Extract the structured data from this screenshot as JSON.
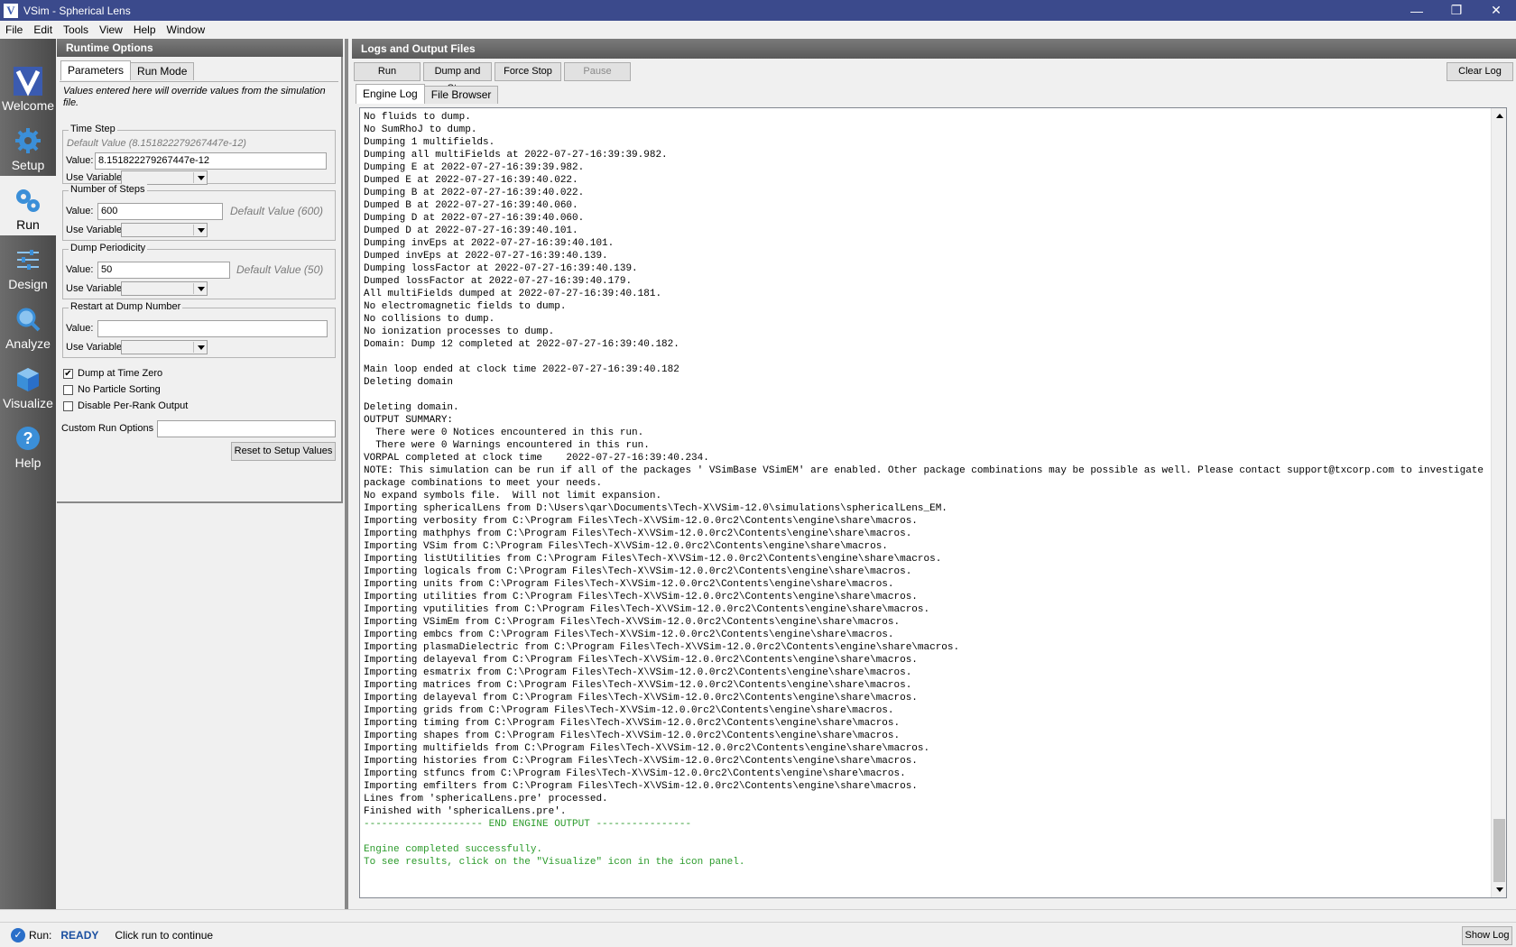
{
  "window": {
    "title": "VSim - Spherical Lens",
    "app_icon": "V",
    "minimize": "—",
    "restore": "❐",
    "close": "✕"
  },
  "menu": [
    "File",
    "Edit",
    "Tools",
    "View",
    "Help",
    "Window"
  ],
  "iconpanel": {
    "items": [
      {
        "label": "Welcome",
        "icon": "vsim-logo-icon"
      },
      {
        "label": "Setup",
        "icon": "gear-icon"
      },
      {
        "label": "Run",
        "icon": "gears-icon",
        "active": true
      },
      {
        "label": "Design",
        "icon": "sliders-icon"
      },
      {
        "label": "Analyze",
        "icon": "magnifier-icon"
      },
      {
        "label": "Visualize",
        "icon": "cube-icon"
      },
      {
        "label": "Help",
        "icon": "question-icon"
      }
    ]
  },
  "runtime": {
    "header": "Runtime Options",
    "tabs": [
      "Parameters",
      "Run Mode"
    ],
    "note": "Values entered here will override values from the simulation file.",
    "time_step": {
      "title": "Time Step",
      "default": "Default Value (8.151822279267447e-12)",
      "value_label": "Value:",
      "value": "8.151822279267447e-12",
      "use_var_label": "Use Variable:"
    },
    "num_steps": {
      "title": "Number of Steps",
      "value_label": "Value:",
      "value": "600",
      "default": "Default Value (600)",
      "use_var_label": "Use Variable:"
    },
    "dump_periodicity": {
      "title": "Dump Periodicity",
      "value_label": "Value:",
      "value": "50",
      "default": "Default Value (50)",
      "use_var_label": "Use Variable:"
    },
    "restart": {
      "title": "Restart at Dump Number",
      "value_label": "Value:",
      "value": "",
      "use_var_label": "Use Variable:"
    },
    "checkboxes": [
      {
        "label": "Dump at Time Zero",
        "checked": true
      },
      {
        "label": "No Particle Sorting",
        "checked": false
      },
      {
        "label": "Disable Per-Rank Output",
        "checked": false
      }
    ],
    "custom_label": "Custom Run Options",
    "custom_value": "",
    "reset_label": "Reset to Setup Values"
  },
  "logs": {
    "header": "Logs and Output Files",
    "buttons": {
      "run": "Run",
      "dump_stop": "Dump and Stop",
      "force_stop": "Force Stop",
      "pause": "Pause",
      "clear": "Clear Log"
    },
    "tabs": [
      "Engine Log",
      "File Browser"
    ],
    "lines": [
      {
        "text": "No fluids to dump."
      },
      {
        "text": "No SumRhoJ to dump."
      },
      {
        "text": "Dumping 1 multifields."
      },
      {
        "text": "Dumping all multiFields at 2022-07-27-16:39:39.982."
      },
      {
        "text": "Dumping E at 2022-07-27-16:39:39.982."
      },
      {
        "text": "Dumped E at 2022-07-27-16:39:40.022."
      },
      {
        "text": "Dumping B at 2022-07-27-16:39:40.022."
      },
      {
        "text": "Dumped B at 2022-07-27-16:39:40.060."
      },
      {
        "text": "Dumping D at 2022-07-27-16:39:40.060."
      },
      {
        "text": "Dumped D at 2022-07-27-16:39:40.101."
      },
      {
        "text": "Dumping invEps at 2022-07-27-16:39:40.101."
      },
      {
        "text": "Dumped invEps at 2022-07-27-16:39:40.139."
      },
      {
        "text": "Dumping lossFactor at 2022-07-27-16:39:40.139."
      },
      {
        "text": "Dumped lossFactor at 2022-07-27-16:39:40.179."
      },
      {
        "text": "All multiFields dumped at 2022-07-27-16:39:40.181."
      },
      {
        "text": "No electromagnetic fields to dump."
      },
      {
        "text": "No collisions to dump."
      },
      {
        "text": "No ionization processes to dump."
      },
      {
        "text": "Domain: Dump 12 completed at 2022-07-27-16:39:40.182."
      },
      {
        "text": " "
      },
      {
        "text": "Main loop ended at clock time 2022-07-27-16:39:40.182"
      },
      {
        "text": "Deleting domain"
      },
      {
        "text": " "
      },
      {
        "text": "Deleting domain."
      },
      {
        "text": "OUTPUT SUMMARY:"
      },
      {
        "text": "  There were 0 Notices encountered in this run."
      },
      {
        "text": "  There were 0 Warnings encountered in this run."
      },
      {
        "text": "VORPAL completed at clock time    2022-07-27-16:39:40.234."
      },
      {
        "text": "NOTE: This simulation can be run if all of the packages ' VSimBase VSimEM' are enabled. Other package combinations may be possible as well. Please contact support@txcorp.com to investigate package combinations to meet your needs."
      },
      {
        "text": "No expand symbols file.  Will not limit expansion."
      },
      {
        "text": "Importing sphericalLens from D:\\Users\\qar\\Documents\\Tech-X\\VSim-12.0\\simulations\\sphericalLens_EM."
      },
      {
        "text": "Importing verbosity from C:\\Program Files\\Tech-X\\VSim-12.0.0rc2\\Contents\\engine\\share\\macros."
      },
      {
        "text": "Importing mathphys from C:\\Program Files\\Tech-X\\VSim-12.0.0rc2\\Contents\\engine\\share\\macros."
      },
      {
        "text": "Importing VSim from C:\\Program Files\\Tech-X\\VSim-12.0.0rc2\\Contents\\engine\\share\\macros."
      },
      {
        "text": "Importing listUtilities from C:\\Program Files\\Tech-X\\VSim-12.0.0rc2\\Contents\\engine\\share\\macros."
      },
      {
        "text": "Importing logicals from C:\\Program Files\\Tech-X\\VSim-12.0.0rc2\\Contents\\engine\\share\\macros."
      },
      {
        "text": "Importing units from C:\\Program Files\\Tech-X\\VSim-12.0.0rc2\\Contents\\engine\\share\\macros."
      },
      {
        "text": "Importing utilities from C:\\Program Files\\Tech-X\\VSim-12.0.0rc2\\Contents\\engine\\share\\macros."
      },
      {
        "text": "Importing vputilities from C:\\Program Files\\Tech-X\\VSim-12.0.0rc2\\Contents\\engine\\share\\macros."
      },
      {
        "text": "Importing VSimEm from C:\\Program Files\\Tech-X\\VSim-12.0.0rc2\\Contents\\engine\\share\\macros."
      },
      {
        "text": "Importing embcs from C:\\Program Files\\Tech-X\\VSim-12.0.0rc2\\Contents\\engine\\share\\macros."
      },
      {
        "text": "Importing plasmaDielectric from C:\\Program Files\\Tech-X\\VSim-12.0.0rc2\\Contents\\engine\\share\\macros."
      },
      {
        "text": "Importing delayeval from C:\\Program Files\\Tech-X\\VSim-12.0.0rc2\\Contents\\engine\\share\\macros."
      },
      {
        "text": "Importing esmatrix from C:\\Program Files\\Tech-X\\VSim-12.0.0rc2\\Contents\\engine\\share\\macros."
      },
      {
        "text": "Importing matrices from C:\\Program Files\\Tech-X\\VSim-12.0.0rc2\\Contents\\engine\\share\\macros."
      },
      {
        "text": "Importing delayeval from C:\\Program Files\\Tech-X\\VSim-12.0.0rc2\\Contents\\engine\\share\\macros."
      },
      {
        "text": "Importing grids from C:\\Program Files\\Tech-X\\VSim-12.0.0rc2\\Contents\\engine\\share\\macros."
      },
      {
        "text": "Importing timing from C:\\Program Files\\Tech-X\\VSim-12.0.0rc2\\Contents\\engine\\share\\macros."
      },
      {
        "text": "Importing shapes from C:\\Program Files\\Tech-X\\VSim-12.0.0rc2\\Contents\\engine\\share\\macros."
      },
      {
        "text": "Importing multifields from C:\\Program Files\\Tech-X\\VSim-12.0.0rc2\\Contents\\engine\\share\\macros."
      },
      {
        "text": "Importing histories from C:\\Program Files\\Tech-X\\VSim-12.0.0rc2\\Contents\\engine\\share\\macros."
      },
      {
        "text": "Importing stfuncs from C:\\Program Files\\Tech-X\\VSim-12.0.0rc2\\Contents\\engine\\share\\macros."
      },
      {
        "text": "Importing emfilters from C:\\Program Files\\Tech-X\\VSim-12.0.0rc2\\Contents\\engine\\share\\macros."
      },
      {
        "text": "Lines from 'sphericalLens.pre' processed."
      },
      {
        "text": "Finished with 'sphericalLens.pre'."
      },
      {
        "text": "-------------------- END ENGINE OUTPUT ----------------",
        "color": "green"
      },
      {
        "text": " "
      },
      {
        "text": "Engine completed successfully.",
        "color": "green"
      },
      {
        "text": "To see results, click on the \"Visualize\" icon in the icon panel.",
        "color": "green"
      }
    ]
  },
  "status": {
    "label": "Run:",
    "state": "READY",
    "message": "Click run to continue",
    "show_log": "Show Log"
  }
}
